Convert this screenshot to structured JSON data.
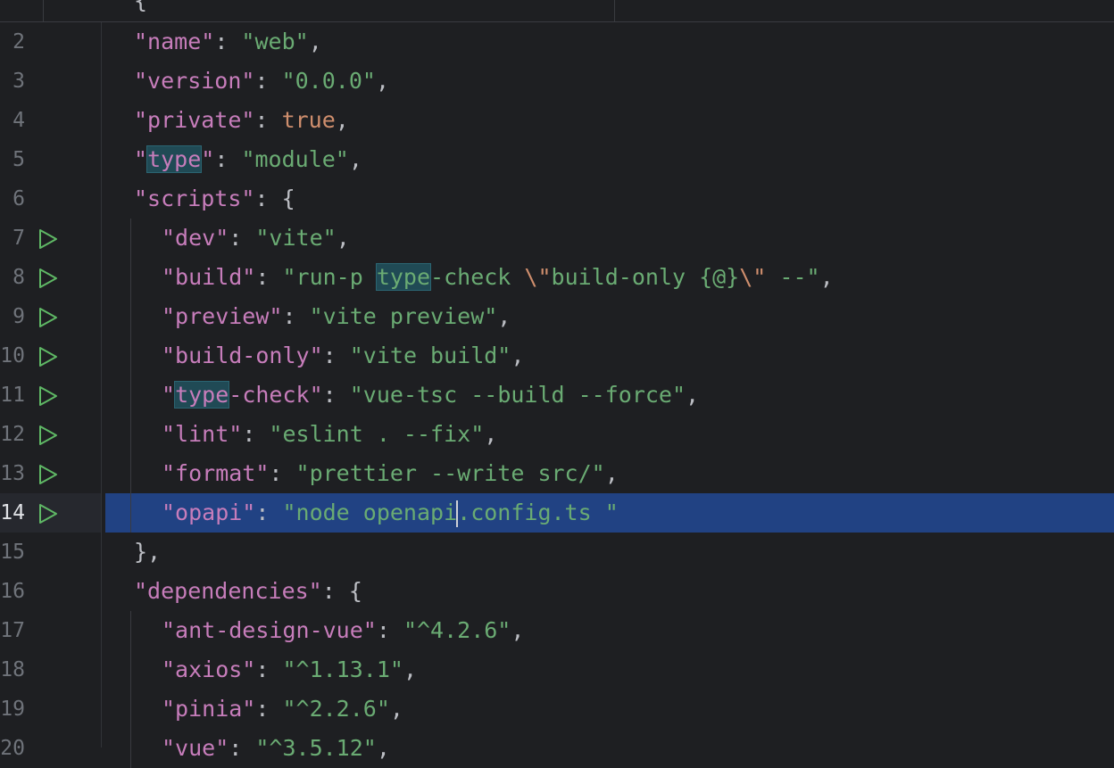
{
  "editor": {
    "top_partial": "{",
    "lines": [
      {
        "num": "2",
        "indent": 1,
        "runnable": false,
        "active": false,
        "parts": [
          {
            "t": "\"name\"",
            "c": "k"
          },
          {
            "t": ": ",
            "c": "p"
          },
          {
            "t": "\"web\"",
            "c": "s"
          },
          {
            "t": ",",
            "c": "p"
          }
        ]
      },
      {
        "num": "3",
        "indent": 1,
        "runnable": false,
        "active": false,
        "parts": [
          {
            "t": "\"version\"",
            "c": "k"
          },
          {
            "t": ": ",
            "c": "p"
          },
          {
            "t": "\"0.0.0\"",
            "c": "s"
          },
          {
            "t": ",",
            "c": "p"
          }
        ]
      },
      {
        "num": "4",
        "indent": 1,
        "runnable": false,
        "active": false,
        "parts": [
          {
            "t": "\"private\"",
            "c": "k"
          },
          {
            "t": ": ",
            "c": "p"
          },
          {
            "t": "true",
            "c": "b"
          },
          {
            "t": ",",
            "c": "p"
          }
        ]
      },
      {
        "num": "5",
        "indent": 1,
        "runnable": false,
        "active": false,
        "parts": [
          {
            "t": "\"",
            "c": "k"
          },
          {
            "t": "type",
            "c": "k",
            "mark": true
          },
          {
            "t": "\"",
            "c": "k"
          },
          {
            "t": ": ",
            "c": "p"
          },
          {
            "t": "\"module\"",
            "c": "s"
          },
          {
            "t": ",",
            "c": "p"
          }
        ]
      },
      {
        "num": "6",
        "indent": 1,
        "runnable": false,
        "active": false,
        "parts": [
          {
            "t": "\"scripts\"",
            "c": "k"
          },
          {
            "t": ": {",
            "c": "p"
          }
        ]
      },
      {
        "num": "7",
        "indent": 2,
        "runnable": true,
        "active": false,
        "parts": [
          {
            "t": "\"dev\"",
            "c": "k"
          },
          {
            "t": ": ",
            "c": "p"
          },
          {
            "t": "\"vite\"",
            "c": "s"
          },
          {
            "t": ",",
            "c": "p"
          }
        ]
      },
      {
        "num": "8",
        "indent": 2,
        "runnable": true,
        "active": false,
        "parts": [
          {
            "t": "\"build\"",
            "c": "k"
          },
          {
            "t": ": ",
            "c": "p"
          },
          {
            "t": "\"run-p ",
            "c": "s"
          },
          {
            "t": "type",
            "c": "s",
            "mark": true
          },
          {
            "t": "-check ",
            "c": "s"
          },
          {
            "t": "\\\"",
            "c": "esc"
          },
          {
            "t": "build-only {@}",
            "c": "s"
          },
          {
            "t": "\\\"",
            "c": "esc"
          },
          {
            "t": " --\"",
            "c": "s"
          },
          {
            "t": ",",
            "c": "p"
          }
        ]
      },
      {
        "num": "9",
        "indent": 2,
        "runnable": true,
        "active": false,
        "parts": [
          {
            "t": "\"preview\"",
            "c": "k"
          },
          {
            "t": ": ",
            "c": "p"
          },
          {
            "t": "\"vite preview\"",
            "c": "s"
          },
          {
            "t": ",",
            "c": "p"
          }
        ]
      },
      {
        "num": "10",
        "indent": 2,
        "runnable": true,
        "active": false,
        "parts": [
          {
            "t": "\"build-only\"",
            "c": "k"
          },
          {
            "t": ": ",
            "c": "p"
          },
          {
            "t": "\"vite build\"",
            "c": "s"
          },
          {
            "t": ",",
            "c": "p"
          }
        ]
      },
      {
        "num": "11",
        "indent": 2,
        "runnable": true,
        "active": false,
        "parts": [
          {
            "t": "\"",
            "c": "k"
          },
          {
            "t": "type",
            "c": "k",
            "mark": true
          },
          {
            "t": "-check\"",
            "c": "k"
          },
          {
            "t": ": ",
            "c": "p"
          },
          {
            "t": "\"vue-tsc --build --force\"",
            "c": "s"
          },
          {
            "t": ",",
            "c": "p"
          }
        ]
      },
      {
        "num": "12",
        "indent": 2,
        "runnable": true,
        "active": false,
        "parts": [
          {
            "t": "\"lint\"",
            "c": "k"
          },
          {
            "t": ": ",
            "c": "p"
          },
          {
            "t": "\"eslint . --fix\"",
            "c": "s"
          },
          {
            "t": ",",
            "c": "p"
          }
        ]
      },
      {
        "num": "13",
        "indent": 2,
        "runnable": true,
        "active": false,
        "parts": [
          {
            "t": "\"format\"",
            "c": "k"
          },
          {
            "t": ": ",
            "c": "p"
          },
          {
            "t": "\"prettier --write src/\"",
            "c": "s"
          },
          {
            "t": ",",
            "c": "p"
          }
        ]
      },
      {
        "num": "14",
        "indent": 2,
        "runnable": true,
        "active": true,
        "parts": [
          {
            "t": "\"opapi\"",
            "c": "k"
          },
          {
            "t": ": ",
            "c": "p"
          },
          {
            "t": "\"node openapi",
            "c": "s"
          },
          {
            "t": "",
            "c": "s",
            "caret": true
          },
          {
            "t": ".config.ts \"",
            "c": "s"
          }
        ]
      },
      {
        "num": "15",
        "indent": 1,
        "runnable": false,
        "active": false,
        "parts": [
          {
            "t": "},",
            "c": "p"
          }
        ]
      },
      {
        "num": "16",
        "indent": 1,
        "runnable": false,
        "active": false,
        "parts": [
          {
            "t": "\"dependencies\"",
            "c": "k"
          },
          {
            "t": ": {",
            "c": "p"
          }
        ]
      },
      {
        "num": "17",
        "indent": 2,
        "runnable": false,
        "active": false,
        "parts": [
          {
            "t": "\"ant-design-vue\"",
            "c": "k"
          },
          {
            "t": ": ",
            "c": "p"
          },
          {
            "t": "\"^4.2.6\"",
            "c": "s"
          },
          {
            "t": ",",
            "c": "p"
          }
        ]
      },
      {
        "num": "18",
        "indent": 2,
        "runnable": false,
        "active": false,
        "parts": [
          {
            "t": "\"axios\"",
            "c": "k"
          },
          {
            "t": ": ",
            "c": "p"
          },
          {
            "t": "\"^1.13.1\"",
            "c": "s"
          },
          {
            "t": ",",
            "c": "p"
          }
        ]
      },
      {
        "num": "19",
        "indent": 2,
        "runnable": false,
        "active": false,
        "parts": [
          {
            "t": "\"pinia\"",
            "c": "k"
          },
          {
            "t": ": ",
            "c": "p"
          },
          {
            "t": "\"^2.2.6\"",
            "c": "s"
          },
          {
            "t": ",",
            "c": "p"
          }
        ]
      },
      {
        "num": "20",
        "indent": 2,
        "runnable": false,
        "active": false,
        "parts": [
          {
            "t": "\"vue\"",
            "c": "k"
          },
          {
            "t": ": ",
            "c": "p"
          },
          {
            "t": "\"^3.5.12\"",
            "c": "s"
          },
          {
            "t": ",",
            "c": "p"
          }
        ]
      }
    ],
    "icons": {
      "run": "run-gutter-icon"
    },
    "colors": {
      "background": "#1e1f22",
      "key": "#c77dbb",
      "string": "#6aab73",
      "keyword": "#cf8e6d",
      "selection": "#214283",
      "run_icon": "#5fb865"
    }
  }
}
